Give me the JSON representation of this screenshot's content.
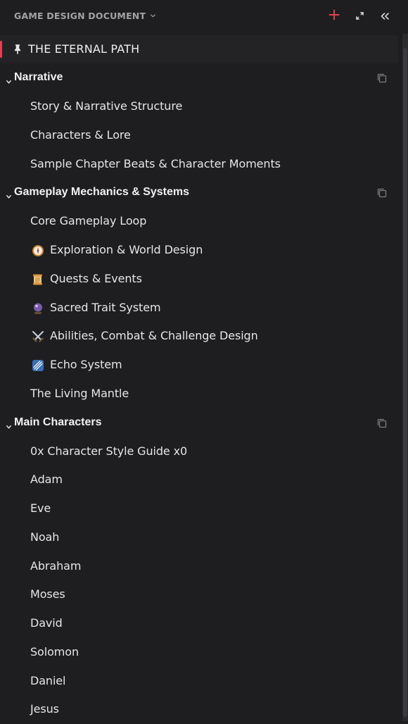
{
  "header": {
    "doc_title": "GAME DESIGN DOCUMENT"
  },
  "pinned": {
    "label": "THE ETERNAL PATH"
  },
  "colors": {
    "accent": "#e0424d",
    "background": "#1e1e20",
    "pinned_bg": "#232326"
  },
  "sections": [
    {
      "title": "Narrative",
      "items": [
        {
          "label": "Story & Narrative Structure"
        },
        {
          "label": "Characters & Lore"
        },
        {
          "label": "Sample Chapter Beats & Character Moments"
        }
      ]
    },
    {
      "title": "Gameplay Mechanics & Systems",
      "items": [
        {
          "label": "Core Gameplay Loop"
        },
        {
          "label": "Exploration & World Design",
          "icon": "compass-icon"
        },
        {
          "label": "Quests & Events",
          "icon": "scroll-icon"
        },
        {
          "label": "Sacred Trait System",
          "icon": "crystal-ball-icon"
        },
        {
          "label": "Abilities, Combat & Challenge Design",
          "icon": "crossed-swords-icon"
        },
        {
          "label": "Echo System",
          "icon": "comet-icon"
        },
        {
          "label": "The Living Mantle"
        }
      ]
    },
    {
      "title": "Main Characters",
      "items": [
        {
          "label": "0x Character Style Guide x0"
        },
        {
          "label": "Adam"
        },
        {
          "label": "Eve"
        },
        {
          "label": "Noah"
        },
        {
          "label": "Abraham"
        },
        {
          "label": "Moses"
        },
        {
          "label": "David"
        },
        {
          "label": "Solomon"
        },
        {
          "label": "Daniel"
        },
        {
          "label": "Jesus"
        }
      ]
    }
  ]
}
